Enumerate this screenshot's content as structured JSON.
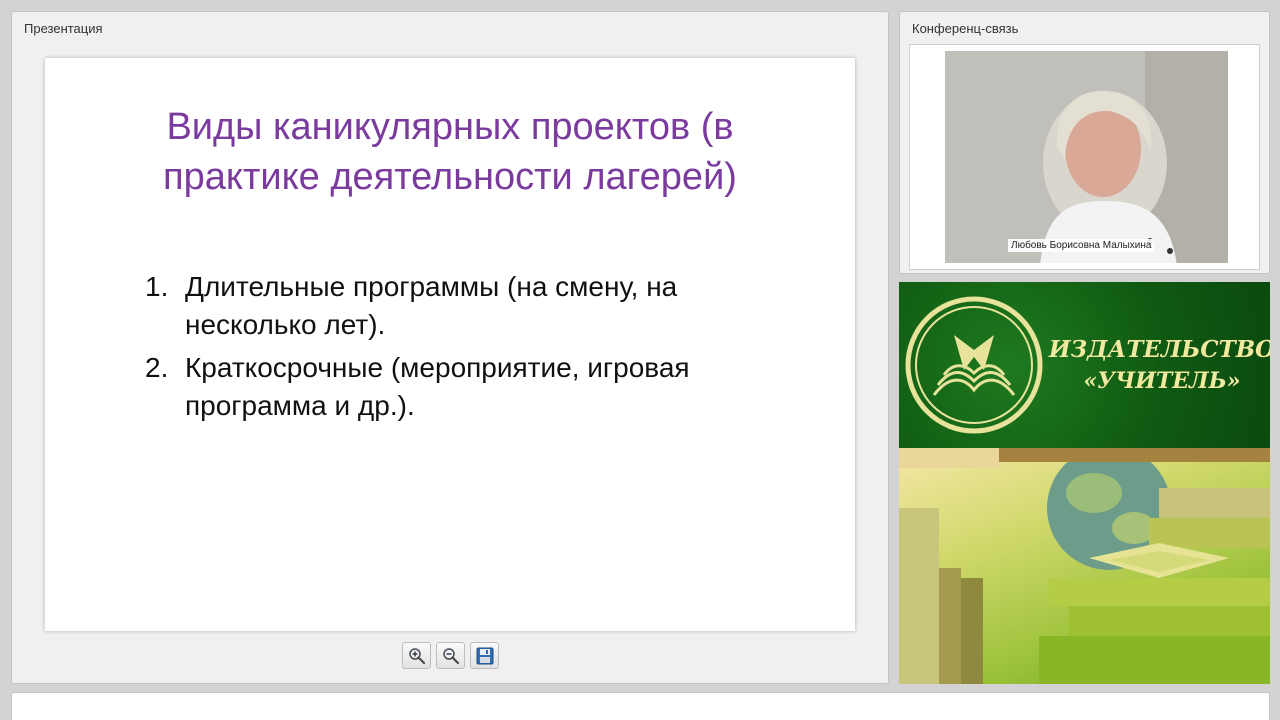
{
  "presentation": {
    "title": "Презентация",
    "slide": {
      "title": "Виды каникулярных проектов (в практике деятельности лагерей)",
      "items": [
        {
          "num": "1.",
          "text": "Длительные программы (на смену, на несколько лет)."
        },
        {
          "num": "2.",
          "text": "Краткосрочные (мероприятие, игровая программа и др.)."
        }
      ]
    },
    "toolbar": {
      "zoom_in_icon": "zoom-in-icon",
      "zoom_out_icon": "zoom-out-icon",
      "save_icon": "floppy-disk-icon"
    }
  },
  "conference": {
    "title": "Конференц-связь",
    "speaker_name": "Любовь Борисовна Малыхина"
  },
  "banner": {
    "line1": "ИЗДАТЕЛЬСТВО",
    "line2": "«УЧИТЕЛЬ»"
  },
  "colors": {
    "slide_title": "#7a3a9e",
    "banner_green": "#0f5a12",
    "banner_text": "#f1e9a0"
  }
}
